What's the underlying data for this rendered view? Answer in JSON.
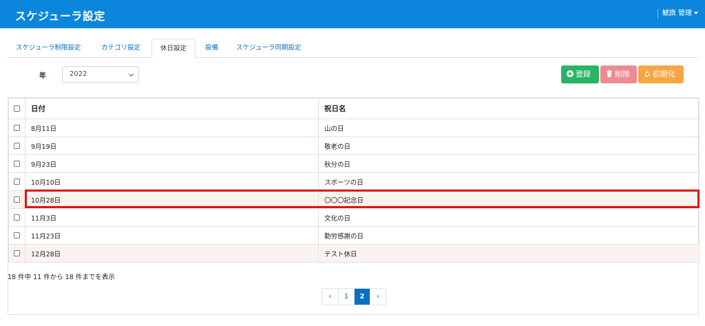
{
  "header": {
    "title": "スケジューラ設定",
    "user": "鯱旗 管理"
  },
  "tabs": [
    {
      "label": "スケジューラ制限設定"
    },
    {
      "label": "カテゴリ設定"
    },
    {
      "label": "休日設定"
    },
    {
      "label": "設備"
    },
    {
      "label": "スケジューラ同期設定"
    }
  ],
  "active_tab": "休日設定",
  "filter": {
    "year_label": "年",
    "year_value": "2022"
  },
  "toolbar": {
    "register_label": "登録",
    "delete_label": "削除",
    "reset_label": "初期化"
  },
  "table": {
    "headers": {
      "date": "日付",
      "holiday": "祝日名"
    },
    "rows": [
      {
        "date": "8月11日",
        "holiday": "山の日"
      },
      {
        "date": "9月19日",
        "holiday": "敬老の日"
      },
      {
        "date": "9月23日",
        "holiday": "秋分の日"
      },
      {
        "date": "10月10日",
        "holiday": "スポーツの日"
      },
      {
        "date": "10月28日",
        "holiday": "〇〇〇記念日"
      },
      {
        "date": "11月3日",
        "holiday": "文化の日"
      },
      {
        "date": "11月23日",
        "holiday": "勤労感謝の日"
      },
      {
        "date": "12月28日",
        "holiday": "テスト休日"
      }
    ]
  },
  "pagination": {
    "info": "18 件中 11 件から 18 件までを表示",
    "prev": "‹",
    "pages": [
      "1",
      "2"
    ],
    "current": "2",
    "next": "›"
  },
  "colors": {
    "header_bg": "#0b86dc",
    "register": "#28b463",
    "delete": "#ee8a93",
    "reset": "#f8a542",
    "highlight": "#e21212"
  }
}
